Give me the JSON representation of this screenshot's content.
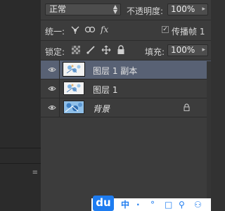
{
  "panel": {
    "blend_mode": "正常",
    "opacity_label": "不透明度:",
    "opacity_value": "100%",
    "unify_label": "统一:",
    "propagate_label": "传播帧 1",
    "propagate_checked": true,
    "lock_label": "锁定:",
    "fill_label": "填充:",
    "fill_value": "100%"
  },
  "layers": [
    {
      "name": "图层 1 副本",
      "visible": true,
      "selected": true,
      "locked": false
    },
    {
      "name": "图层 1",
      "visible": true,
      "selected": false,
      "locked": false
    },
    {
      "name": "背景",
      "visible": true,
      "selected": false,
      "locked": true
    }
  ],
  "taskbar": {
    "logo": "du",
    "tray": [
      "中",
      "·",
      "°",
      "□",
      "⚲",
      "⚇"
    ]
  },
  "colors": {
    "panel_bg": "#3c3c3c",
    "selected_layer": "#586174",
    "taskbar_accent": "#1e7cf0"
  }
}
